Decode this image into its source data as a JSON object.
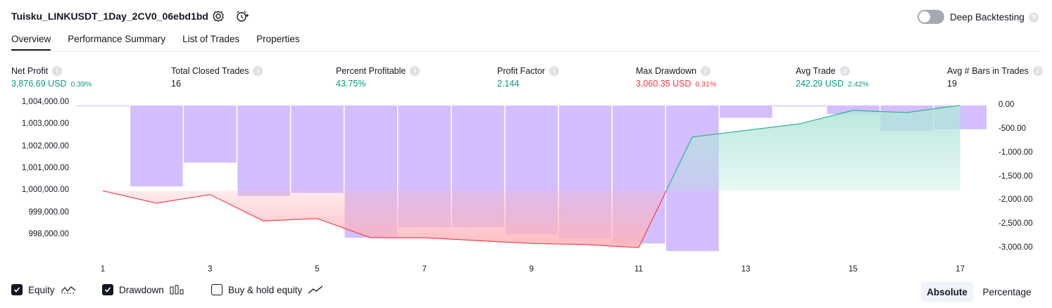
{
  "header": {
    "strategy_title": "Tuisku_LINKUSDT_1Day_2CV0_06ebd1bd",
    "deep_backtesting_label": "Deep Backtesting",
    "help_glyph": "?"
  },
  "tabs": [
    {
      "label": "Overview"
    },
    {
      "label": "Performance Summary"
    },
    {
      "label": "List of Trades"
    },
    {
      "label": "Properties"
    }
  ],
  "stats": [
    {
      "label": "Net Profit",
      "value": "3,876.69 USD",
      "pct": "0.39%",
      "color": "#089981"
    },
    {
      "label": "Total Closed Trades",
      "value": "16",
      "pct": "",
      "color": "#131722"
    },
    {
      "label": "Percent Profitable",
      "value": "43.75%",
      "pct": "",
      "color": "#089981"
    },
    {
      "label": "Profit Factor",
      "value": "2.144",
      "pct": "",
      "color": "#089981"
    },
    {
      "label": "Max Drawdown",
      "value": "3,060.35 USD",
      "pct": "0.31%",
      "color": "#f23645"
    },
    {
      "label": "Avg Trade",
      "value": "242.29 USD",
      "pct": "2.42%",
      "color": "#089981"
    },
    {
      "label": "Avg # Bars in Trades",
      "value": "19",
      "pct": "",
      "color": "#131722"
    }
  ],
  "chart_data": {
    "type": "line",
    "x": [
      1,
      2,
      3,
      4,
      5,
      6,
      7,
      8,
      9,
      10,
      11,
      12,
      13,
      14,
      15,
      16,
      17
    ],
    "x_tick_labels": [
      "1",
      "3",
      "5",
      "7",
      "9",
      "11",
      "13",
      "15",
      "17"
    ],
    "left_axis_ticks": [
      "1,004,000.00",
      "1,003,000.00",
      "1,002,000.00",
      "1,001,000.00",
      "1,000,000.00",
      "999,000.00",
      "998,000.00"
    ],
    "right_axis_ticks": [
      "0.00",
      "-500.00",
      "-1,000.00",
      "-1,500.00",
      "-2,000.00",
      "-2,500.00",
      "-3,000.00"
    ],
    "ylim_left": [
      997500,
      1004200
    ],
    "ylim_right": [
      -3150,
      0
    ],
    "series": [
      {
        "name": "Equity",
        "axis": "left",
        "values": [
          1000000,
          999440,
          999830,
          998630,
          998740,
          997870,
          997870,
          997740,
          997610,
          997560,
          997420,
          1002440,
          1002740,
          1003040,
          1003650,
          1003550,
          1003880
        ]
      },
      {
        "name": "Drawdown",
        "axis": "right",
        "kind": "bar",
        "values": [
          -5,
          -1700,
          -1200,
          -1900,
          -1840,
          -2780,
          -2560,
          -2560,
          -2710,
          -2800,
          -2900,
          -3060,
          -260,
          -20,
          -180,
          -530,
          -500
        ]
      }
    ],
    "baseline_left": 1000000,
    "colors": {
      "profit_line": "#22ab94",
      "loss_line": "#f23645",
      "drawdown_bar": "#cdb3ff",
      "profit_fill": "#b2e6da",
      "loss_fill": "#ffb3b8"
    },
    "legend": {
      "position": "bottom-left"
    }
  },
  "legend": [
    {
      "label": "Equity",
      "checked": true,
      "icon": "equity-line-icon"
    },
    {
      "label": "Drawdown",
      "checked": true,
      "icon": "drawdown-bars-icon"
    },
    {
      "label": "Buy & hold equity",
      "checked": false,
      "icon": "buy-hold-line-icon"
    }
  ],
  "view_toggle": {
    "absolute": "Absolute",
    "percentage": "Percentage",
    "selected": "Absolute"
  }
}
